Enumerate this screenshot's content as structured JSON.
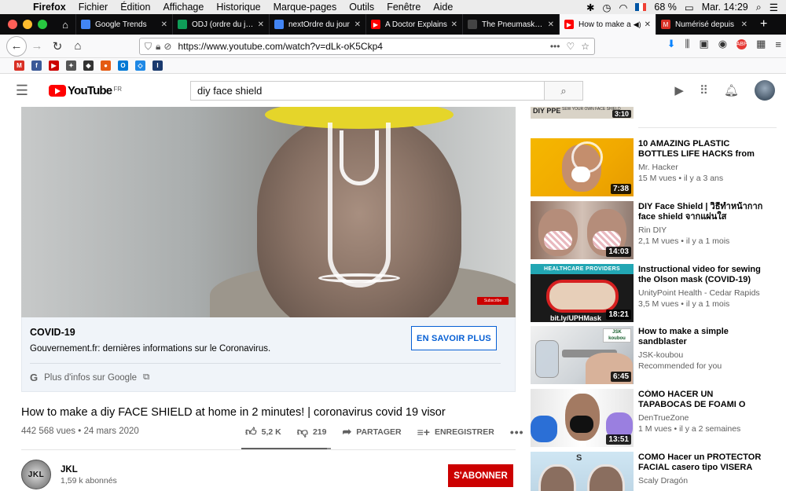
{
  "menubar": {
    "app": "Firefox",
    "items": [
      "Fichier",
      "Édition",
      "Affichage",
      "Historique",
      "Marque-pages",
      "Outils",
      "Fenêtre",
      "Aide"
    ],
    "battery": "68 %",
    "clock": "Mar. 14:29"
  },
  "tabs": [
    {
      "title": "Google Trends",
      "color": "#4285f4"
    },
    {
      "title": "ODJ (ordre du jour",
      "color": "#0f9d58"
    },
    {
      "title": "nextOrdre du jour",
      "color": "#4285f4"
    },
    {
      "title": "A Doctor Explains",
      "color": "#ff0000"
    },
    {
      "title": "The Pneumask Pro",
      "color": "#444444"
    },
    {
      "title": "How to make a",
      "color": "#ff0000",
      "active": true
    },
    {
      "title": "Numérisé depuis",
      "color": "#d93025"
    }
  ],
  "browser": {
    "url": "https://www.youtube.com/watch?v=dLk-oK5Ckp4"
  },
  "bookmarks": [
    {
      "label": "M",
      "color": "#d93025"
    },
    {
      "label": "f",
      "color": "#3b5998"
    },
    {
      "label": "▶",
      "color": "#cc0000"
    },
    {
      "label": "✦",
      "color": "#555555"
    },
    {
      "label": "◆",
      "color": "#333333"
    },
    {
      "label": "●",
      "color": "#e55b13"
    },
    {
      "label": "O",
      "color": "#0078d4"
    },
    {
      "label": "◇",
      "color": "#1e88e5"
    },
    {
      "label": "I",
      "color": "#1a3a6e"
    }
  ],
  "youtube": {
    "logo_text": "YouTube",
    "country": "FR",
    "search_value": "diy face shield"
  },
  "player": {
    "subscribe_watermark": "Subscribe"
  },
  "covid": {
    "heading": "COVID-19",
    "description": "Gouvernement.fr: dernières informations sur le Coronavirus.",
    "button": "EN SAVOIR PLUS",
    "google_link": "Plus d'infos sur Google"
  },
  "video": {
    "title": "How to make a diy FACE SHIELD at home in 2 minutes! | coronavirus covid 19 visor",
    "views": "442 568 vues",
    "date": "24 mars 2020",
    "likes": "5,2 K",
    "dislikes": "219",
    "like_ratio": 0.96,
    "share": "PARTAGER",
    "save": "ENREGISTRER"
  },
  "channel": {
    "avatar_text": "JKL",
    "name": "JKL",
    "subscribers": "1,59 k abonnés",
    "subscribe_button": "S'ABONNER"
  },
  "top_suggestion": {
    "thumb_text": "DIY PPE",
    "thumb_subtext": "SEW YOUR OWN FACE SHIELD",
    "duration": "3:10"
  },
  "suggestions": [
    {
      "title": "10 AMAZING PLASTIC BOTTLES LIFE HACKS from Mr...",
      "channel": "Mr. Hacker",
      "meta": "15 M vues • il y a 3 ans",
      "duration": "7:38"
    },
    {
      "title": "DIY Face Shield | วิธีทำหน้ากาก face shield จากแผ่นใส",
      "channel": "Rin DIY",
      "meta": "2,1 M vues • il y a 1 mois",
      "duration": "14:03"
    },
    {
      "title": "Instructional video for sewing the Olson mask (COVID-19)",
      "channel": "UnityPoint Health - Cedar Rapids",
      "meta": "3,5 M vues • il y a 1 mois",
      "duration": "18:21",
      "thumb_header": "HEALTHCARE PROVIDERS",
      "thumb_footer": "bit.ly/UPHMask"
    },
    {
      "title": "How to make a simple sandblaster",
      "channel": "JSK-koubou",
      "meta": "Recommended for you",
      "duration": "6:45",
      "thumb_logo": "JSK koubou"
    },
    {
      "title": "CÓMO HACER UN TAPABOCAS DE FOAMI O GOMA EVA CON...",
      "channel": "DenTrueZone",
      "meta": "1 M vues • il y a 2 semaines",
      "duration": "13:51"
    },
    {
      "title": "COMO Hacer un PROTECTOR FACIAL casero tipo VISERA",
      "channel": "Scaly Dragón",
      "meta": "",
      "duration": "",
      "thumb_logo": "S"
    }
  ]
}
